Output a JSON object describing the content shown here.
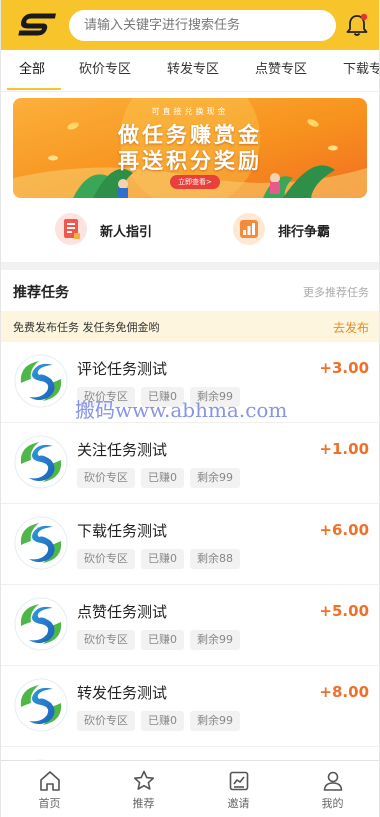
{
  "header": {
    "search_placeholder": "请输入关键字进行搜索任务",
    "brand_color": "#f8c42c",
    "logo_icon": "logo-s-icon",
    "bell_icon": "bell-icon"
  },
  "tabs": [
    {
      "label": "全部",
      "active": true
    },
    {
      "label": "砍价专区"
    },
    {
      "label": "转发专区"
    },
    {
      "label": "点赞专区"
    },
    {
      "label": "下载专"
    }
  ],
  "banner": {
    "small_text": "可直接兑换现金",
    "line1": "做任务赚赏金",
    "line2": "再送积分奖励",
    "button": "立即查看>"
  },
  "quick_links": [
    {
      "label": "新人指引",
      "icon": "guide-icon"
    },
    {
      "label": "排行争霸",
      "icon": "ranking-icon"
    }
  ],
  "section": {
    "title": "推荐任务",
    "more": "更多推荐任务"
  },
  "notice": {
    "text": "免费发布任务 发任务免佣金哟",
    "link": "去发布"
  },
  "tasks": [
    {
      "title": "评论任务测试",
      "tags": [
        "砍价专区",
        "已赚0",
        "剩余99"
      ],
      "reward": "+3.00"
    },
    {
      "title": "关注任务测试",
      "tags": [
        "砍价专区",
        "已赚0",
        "剩余99"
      ],
      "reward": "+1.00"
    },
    {
      "title": "下载任务测试",
      "tags": [
        "砍价专区",
        "已赚0",
        "剩余88"
      ],
      "reward": "+6.00"
    },
    {
      "title": "点赞任务测试",
      "tags": [
        "砍价专区",
        "已赚0",
        "剩余99"
      ],
      "reward": "+5.00"
    },
    {
      "title": "转发任务测试",
      "tags": [
        "砍价专区",
        "已赚0",
        "剩余99"
      ],
      "reward": "+8.00"
    },
    {
      "title": "",
      "tags": [],
      "reward": ""
    }
  ],
  "watermark": "搬码www.abhma.com",
  "bottom_nav": [
    {
      "label": "首页",
      "icon": "home-icon"
    },
    {
      "label": "推荐",
      "icon": "star-icon"
    },
    {
      "label": "邀请",
      "icon": "invite-icon"
    },
    {
      "label": "我的",
      "icon": "user-icon"
    }
  ],
  "colors": {
    "accent": "#f8c42c",
    "reward": "#f07029",
    "notice_bg": "#fdf5de",
    "notice_link": "#e98a1f"
  }
}
